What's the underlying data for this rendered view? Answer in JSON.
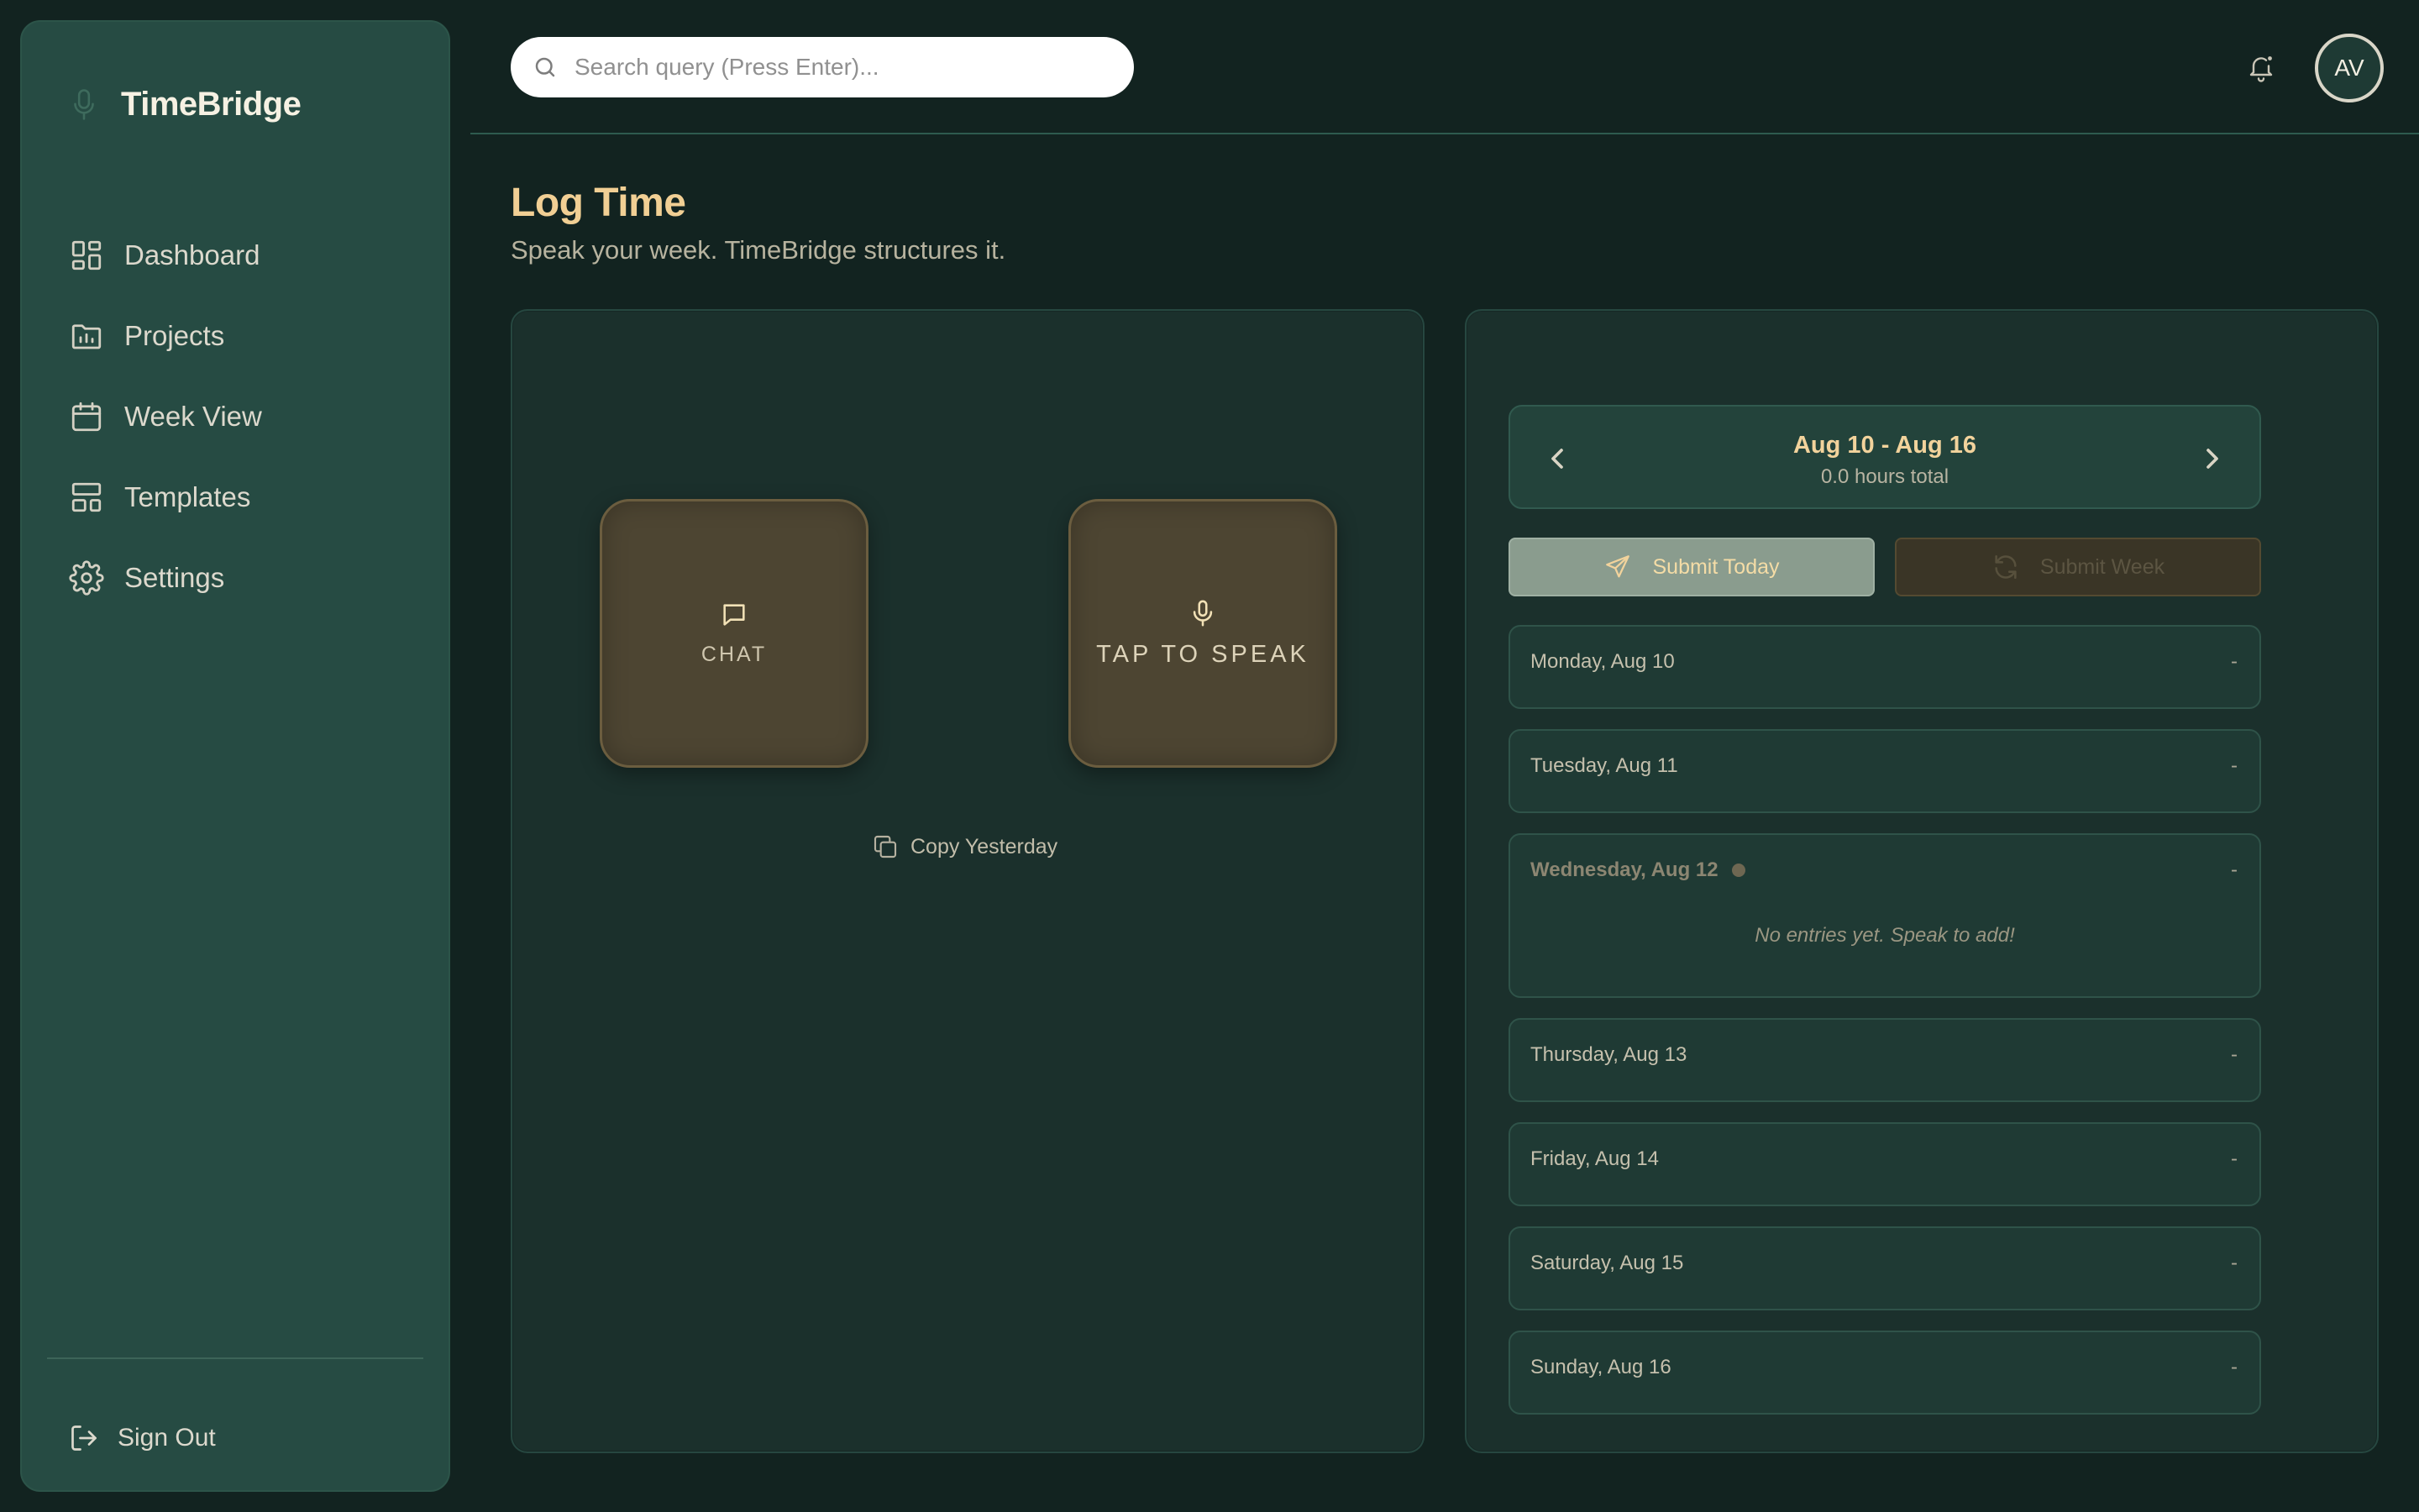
{
  "app": {
    "name": "TimeBridge"
  },
  "sidebar": {
    "items": [
      {
        "label": "Dashboard",
        "icon": "dashboard-icon"
      },
      {
        "label": "Projects",
        "icon": "folder-chart-icon"
      },
      {
        "label": "Week View",
        "icon": "calendar-icon"
      },
      {
        "label": "Templates",
        "icon": "layout-icon"
      },
      {
        "label": "Settings",
        "icon": "gear-icon"
      }
    ],
    "signout_label": "Sign Out"
  },
  "search": {
    "placeholder": "Search query (Press Enter)..."
  },
  "user": {
    "initials": "AV"
  },
  "page": {
    "title": "Log Time",
    "subtitle": "Speak your week. TimeBridge structures it."
  },
  "input_panel": {
    "chat_label": "CHAT",
    "speak_label": "TAP TO SPEAK",
    "copy_label": "Copy Yesterday"
  },
  "week": {
    "range": "Aug 10 - Aug 16",
    "total": "0.0 hours total",
    "submit_today": "Submit Today",
    "submit_week": "Submit Week",
    "days": [
      {
        "name": "Monday, Aug 10",
        "hours": "-"
      },
      {
        "name": "Tuesday, Aug 11",
        "hours": "-"
      },
      {
        "name": "Wednesday, Aug 12",
        "hours": "-",
        "empty": "No entries yet. Speak to add!"
      },
      {
        "name": "Thursday, Aug 13",
        "hours": "-"
      },
      {
        "name": "Friday, Aug 14",
        "hours": "-"
      },
      {
        "name": "Saturday, Aug 15",
        "hours": "-"
      },
      {
        "name": "Sunday, Aug 16",
        "hours": "-"
      }
    ]
  },
  "colors": {
    "background": "#122320",
    "sidebar": "#264b43",
    "accent_gold": "#f1cf94",
    "button_brown": "#4d4532"
  }
}
